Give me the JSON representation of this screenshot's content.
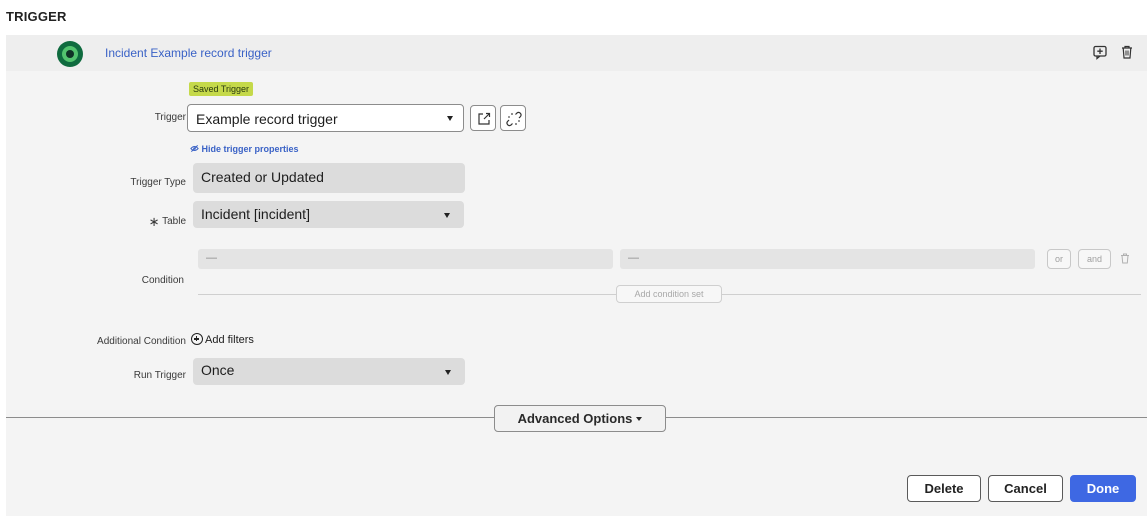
{
  "section_title": "TRIGGER",
  "header": {
    "trigger_name": "Incident Example record trigger",
    "icons": [
      "add-annotation-icon",
      "trash-icon"
    ]
  },
  "badge": "Saved Trigger",
  "trigger": {
    "label": "Trigger",
    "value": "Example record trigger",
    "buttons": [
      "open-external-icon",
      "unlink-icon"
    ]
  },
  "hide_properties_link": "Hide trigger properties",
  "trigger_type": {
    "label": "Trigger Type",
    "value": "Created or Updated"
  },
  "table": {
    "required_marker": "∗",
    "label": "Table",
    "value": "Incident [incident]"
  },
  "condition": {
    "label": "Condition",
    "field_value": "—",
    "operator_value": "—",
    "or_label": "or",
    "and_label": "and",
    "add_condition_set": "Add condition set"
  },
  "additional_condition": {
    "label": "Additional Condition",
    "add_filters": "Add filters"
  },
  "run_trigger": {
    "label": "Run Trigger",
    "value": "Once"
  },
  "advanced_options": "Advanced Options",
  "footer": {
    "delete": "Delete",
    "cancel": "Cancel",
    "done": "Done"
  },
  "colors": {
    "accent": "#3e68e3",
    "link": "#3a62c6",
    "badge": "#c5d94a",
    "panel": "#f4f4f4"
  }
}
